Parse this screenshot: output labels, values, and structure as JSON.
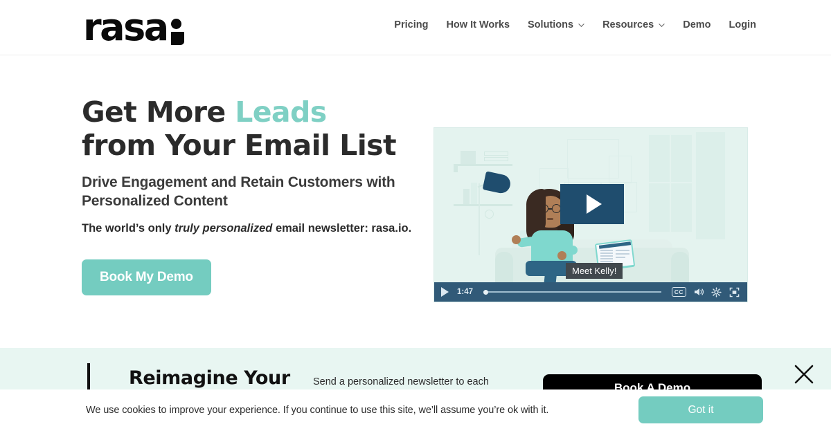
{
  "header": {
    "logo": {
      "word": "rasa",
      "mark": "dot-square-mark"
    },
    "nav": [
      {
        "label": "Pricing",
        "has_dropdown": false
      },
      {
        "label": "How It Works",
        "has_dropdown": false
      },
      {
        "label": "Solutions",
        "has_dropdown": true
      },
      {
        "label": "Resources",
        "has_dropdown": true
      },
      {
        "label": "Demo",
        "has_dropdown": false
      },
      {
        "label": "Login",
        "has_dropdown": false
      }
    ]
  },
  "hero": {
    "headline_line1_plain": "Get More ",
    "headline_line1_accent": "Leads",
    "headline_line2": "from Your Email List",
    "subheadline": "Drive Engagement and Retain Customers with Personalized Content",
    "lede_before": "The world’s only ",
    "lede_italic": "truly personalized",
    "lede_after": " email newsletter: rasa.io.",
    "cta_label": "Book My Demo"
  },
  "video": {
    "caption": "Meet Kelly!",
    "play_label": "play-overlay",
    "controls": {
      "play": "play-icon",
      "time": "1:47",
      "cc": "CC",
      "volume": "volume-icon",
      "settings": "gear-icon",
      "fullscreen": "fullscreen-icon"
    }
  },
  "section2": {
    "title": "Reimagine Your",
    "body": "Send a personalized newsletter to each individual person on your email list. Sounds",
    "button_label": "Book A Demo",
    "close_label": "close-icon"
  },
  "cookie": {
    "message": "We use cookies to improve your experience. If you continue to use this site, we’ll assume you’re ok with it.",
    "accept_label": "Got it"
  },
  "colors": {
    "accent_mint": "#7fd0c4",
    "button_teal": "#74ccc0",
    "band_mint": "#e8f6f2",
    "video_blue": "#1f4d6e",
    "control_bar": "#315a78",
    "text_dark": "#2b2b2b"
  }
}
